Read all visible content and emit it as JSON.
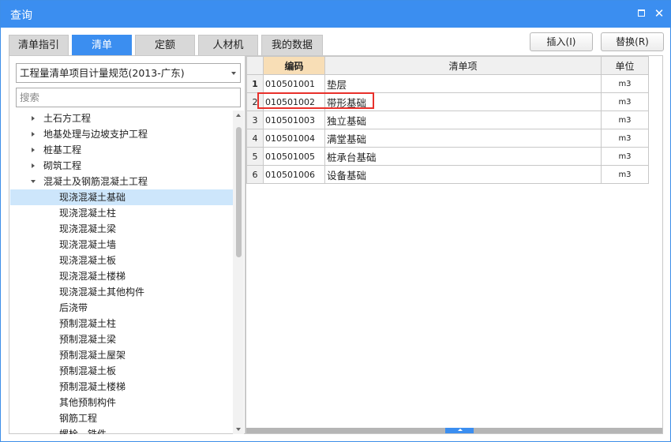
{
  "window": {
    "title": "查询"
  },
  "tabs": [
    {
      "label": "清单指引",
      "active": false
    },
    {
      "label": "清单",
      "active": true
    },
    {
      "label": "定额",
      "active": false
    },
    {
      "label": "人材机",
      "active": false
    },
    {
      "label": "我的数据",
      "active": false
    }
  ],
  "toolbar": {
    "insert_label": "插入(I)",
    "replace_label": "替换(R)"
  },
  "left": {
    "standard_selected": "工程量清单项目计量规范(2013-广东)",
    "search_placeholder": "搜索",
    "tree": [
      {
        "label": "土石方工程",
        "level": 0,
        "expanded": false
      },
      {
        "label": "地基处理与边坡支护工程",
        "level": 0,
        "expanded": false
      },
      {
        "label": "桩基工程",
        "level": 0,
        "expanded": false
      },
      {
        "label": "砌筑工程",
        "level": 0,
        "expanded": false
      },
      {
        "label": "混凝土及钢筋混凝土工程",
        "level": 0,
        "expanded": true
      },
      {
        "label": "现浇混凝土基础",
        "level": 1,
        "selected": true
      },
      {
        "label": "现浇混凝土柱",
        "level": 1
      },
      {
        "label": "现浇混凝土梁",
        "level": 1
      },
      {
        "label": "现浇混凝土墙",
        "level": 1
      },
      {
        "label": "现浇混凝土板",
        "level": 1
      },
      {
        "label": "现浇混凝土楼梯",
        "level": 1
      },
      {
        "label": "现浇混凝土其他构件",
        "level": 1
      },
      {
        "label": "后浇带",
        "level": 1
      },
      {
        "label": "预制混凝土柱",
        "level": 1
      },
      {
        "label": "预制混凝土梁",
        "level": 1
      },
      {
        "label": "预制混凝土屋架",
        "level": 1
      },
      {
        "label": "预制混凝土板",
        "level": 1
      },
      {
        "label": "预制混凝土楼梯",
        "level": 1
      },
      {
        "label": "其他预制构件",
        "level": 1
      },
      {
        "label": "钢筋工程",
        "level": 1
      },
      {
        "label": "螺栓、铁件",
        "level": 1
      }
    ]
  },
  "grid": {
    "headers": {
      "code": "编码",
      "name": "清单项",
      "unit": "单位"
    },
    "rows": [
      {
        "index": "1",
        "code": "010501001",
        "name": "垫层",
        "unit": "m3"
      },
      {
        "index": "2",
        "code": "010501002",
        "name": "带形基础",
        "unit": "m3",
        "highlighted": true
      },
      {
        "index": "3",
        "code": "010501003",
        "name": "独立基础",
        "unit": "m3"
      },
      {
        "index": "4",
        "code": "010501004",
        "name": "满堂基础",
        "unit": "m3"
      },
      {
        "index": "5",
        "code": "010501005",
        "name": "桩承台基础",
        "unit": "m3"
      },
      {
        "index": "6",
        "code": "010501006",
        "name": "设备基础",
        "unit": "m3"
      }
    ]
  },
  "colors": {
    "accent": "#3b8ef0",
    "selected_row": "#cde6fb",
    "code_header": "#f8deb6",
    "highlight_border": "#e8302b"
  }
}
